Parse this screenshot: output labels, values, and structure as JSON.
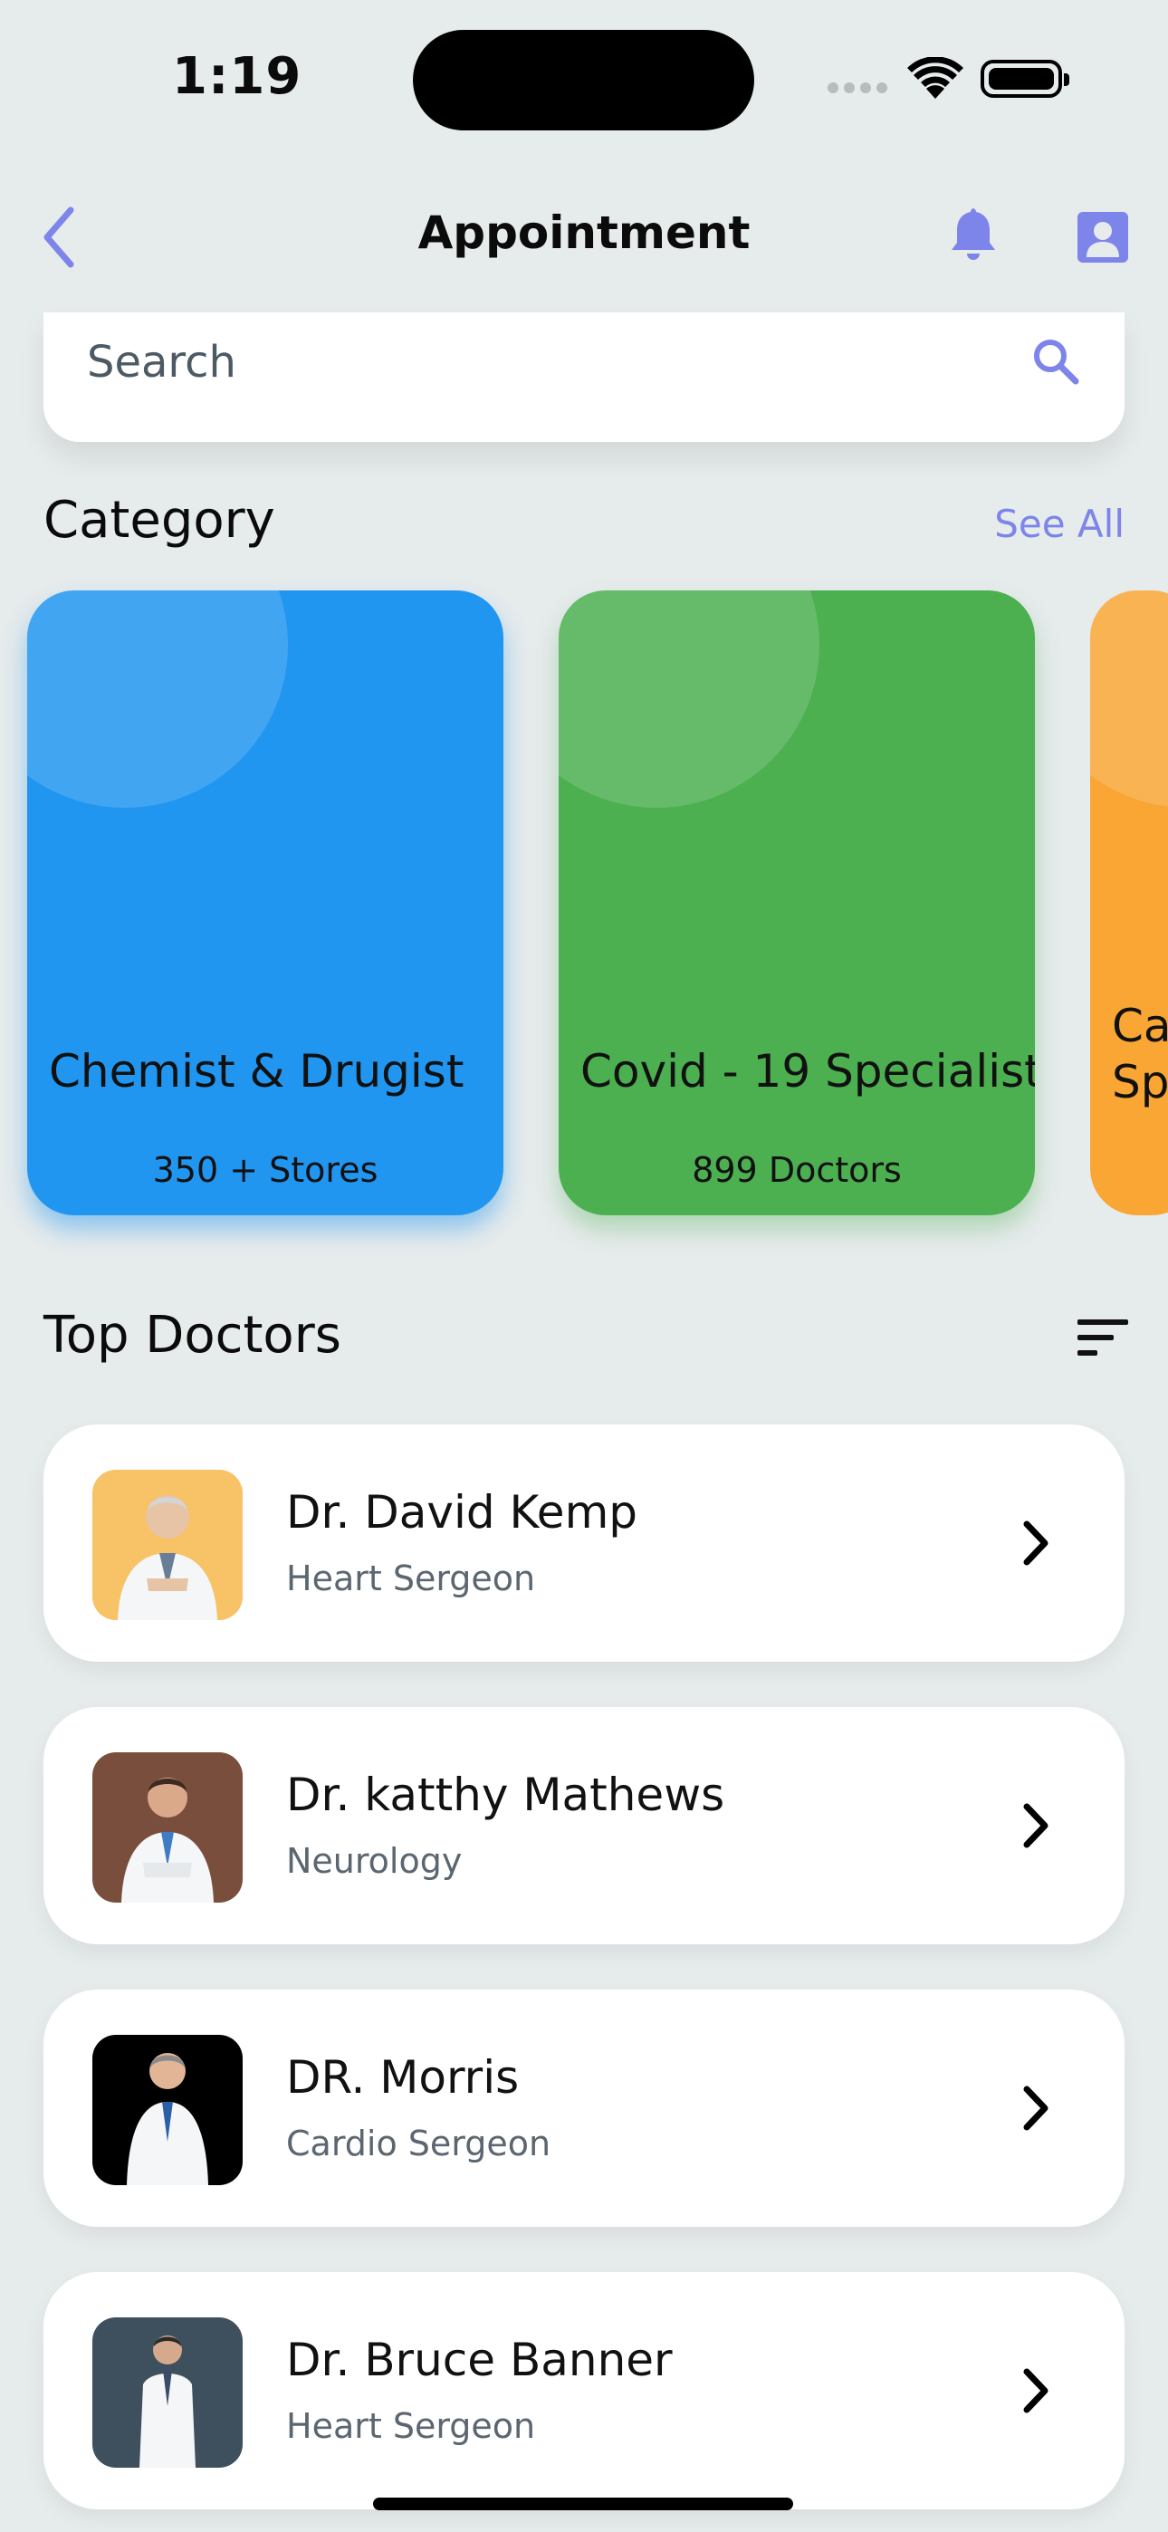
{
  "status_bar": {
    "time": "1:19"
  },
  "header": {
    "title": "Appointment"
  },
  "search": {
    "placeholder": "Search"
  },
  "category": {
    "title": "Category",
    "see_all": "See All",
    "cards": [
      {
        "name": "Chemist & Drugist",
        "count": "350 + Stores",
        "color": "#2196f0"
      },
      {
        "name": "Covid - 19 Specialist",
        "count": "899 Doctors",
        "color": "#4caf50"
      },
      {
        "name": "Ca Sp",
        "line1": "Ca",
        "line2": "Sp",
        "color": "#f9a635"
      }
    ]
  },
  "top_doctors": {
    "title": "Top Doctors",
    "doctors": [
      {
        "name": "Dr. David Kemp",
        "specialty": "Heart Sergeon",
        "photo_bg": "#f8c266"
      },
      {
        "name": "Dr. katthy Mathews",
        "specialty": "Neurology",
        "photo_bg": "#7a4e3c"
      },
      {
        "name": "DR. Morris",
        "specialty": "Cardio Sergeon",
        "photo_bg": "#000000"
      },
      {
        "name": "Dr. Bruce Banner",
        "specialty": "Heart Sergeon",
        "photo_bg": "#3e505e"
      }
    ]
  },
  "colors": {
    "accent": "#7d84ea",
    "background": "#e6ebec"
  }
}
